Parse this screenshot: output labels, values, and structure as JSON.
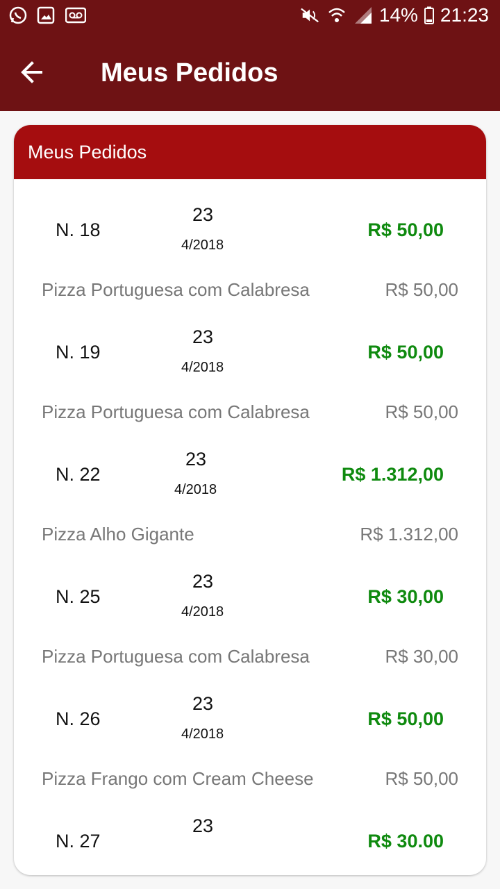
{
  "status_bar": {
    "battery": "14%",
    "time": "21:23",
    "left_icons": [
      "whatsapp-icon",
      "gallery-icon",
      "voicemail-icon"
    ],
    "right_icons": [
      "mute-icon",
      "wifi-icon",
      "signal-icon",
      "battery-icon"
    ]
  },
  "appbar": {
    "title": "Meus Pedidos",
    "back_icon": "arrow-left-icon"
  },
  "card": {
    "header": "Meus Pedidos",
    "orders": [
      {
        "number": "N. 18",
        "day": "23",
        "month_year": "4/2018",
        "total": "R$ 50,00",
        "item": "Pizza Portuguesa com Calabresa",
        "item_price": "R$ 50,00"
      },
      {
        "number": "N. 19",
        "day": "23",
        "month_year": "4/2018",
        "total": "R$ 50,00",
        "item": "Pizza Portuguesa com Calabresa",
        "item_price": "R$ 50,00"
      },
      {
        "number": "N. 22",
        "day": "23",
        "month_year": "4/2018",
        "total": "R$ 1.312,00",
        "item": "Pizza Alho Gigante",
        "item_price": "R$ 1.312,00"
      },
      {
        "number": "N. 25",
        "day": "23",
        "month_year": "4/2018",
        "total": "R$ 30,00",
        "item": "Pizza Portuguesa com Calabresa",
        "item_price": "R$ 30,00"
      },
      {
        "number": "N. 26",
        "day": "23",
        "month_year": "4/2018",
        "total": "R$ 50,00",
        "item": "Pizza Frango com Cream Cheese",
        "item_price": "R$ 50,00"
      },
      {
        "number": "N. 27",
        "day": "23",
        "total": "R$ 30.00"
      }
    ]
  },
  "colors": {
    "appbar": "#6e1214",
    "card_header": "#a50d0f",
    "total_green": "#0f8a0f",
    "item_gray": "#777777"
  }
}
